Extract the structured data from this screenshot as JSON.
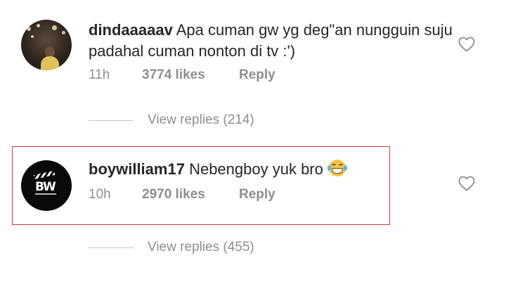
{
  "comments": [
    {
      "username": "dindaaaaav",
      "text": "Apa cuman gw yg deg\"an nungguin suju padahal cuman nonton di tv :')",
      "time": "11h",
      "likes": "3774 likes",
      "reply": "Reply",
      "view_replies": "View replies (214)",
      "avatar_icon": "user-photo-avatar"
    },
    {
      "username": "boywilliam17",
      "text": "Nebengboy yuk bro",
      "emoji": "grinning-sweat-emoji",
      "time": "10h",
      "likes": "2970 likes",
      "reply": "Reply",
      "view_replies": "View replies (455)",
      "avatar_icon": "bw-logo-avatar",
      "avatar_logo_text": "BW",
      "highlighted": true
    }
  ],
  "colors": {
    "text": "#262626",
    "muted": "#8e8e8e",
    "highlight_border": "#d9363e",
    "heart_stroke": "#8e8e8e"
  }
}
